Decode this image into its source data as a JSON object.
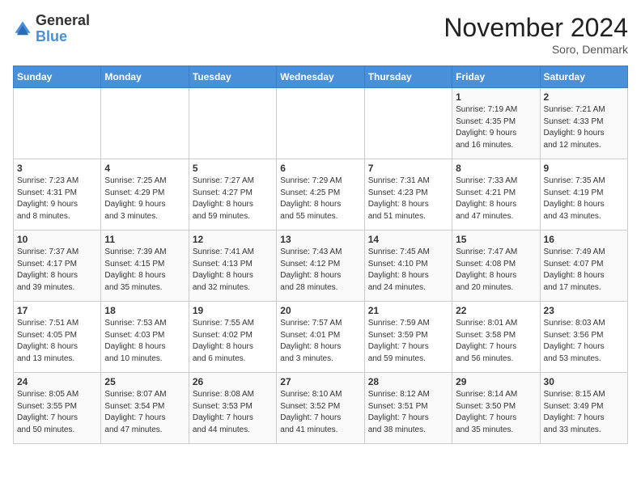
{
  "logo": {
    "line1": "General",
    "line2": "Blue"
  },
  "title": "November 2024",
  "subtitle": "Soro, Denmark",
  "days_of_week": [
    "Sunday",
    "Monday",
    "Tuesday",
    "Wednesday",
    "Thursday",
    "Friday",
    "Saturday"
  ],
  "weeks": [
    [
      {
        "day": "",
        "info": ""
      },
      {
        "day": "",
        "info": ""
      },
      {
        "day": "",
        "info": ""
      },
      {
        "day": "",
        "info": ""
      },
      {
        "day": "",
        "info": ""
      },
      {
        "day": "1",
        "info": "Sunrise: 7:19 AM\nSunset: 4:35 PM\nDaylight: 9 hours\nand 16 minutes."
      },
      {
        "day": "2",
        "info": "Sunrise: 7:21 AM\nSunset: 4:33 PM\nDaylight: 9 hours\nand 12 minutes."
      }
    ],
    [
      {
        "day": "3",
        "info": "Sunrise: 7:23 AM\nSunset: 4:31 PM\nDaylight: 9 hours\nand 8 minutes."
      },
      {
        "day": "4",
        "info": "Sunrise: 7:25 AM\nSunset: 4:29 PM\nDaylight: 9 hours\nand 3 minutes."
      },
      {
        "day": "5",
        "info": "Sunrise: 7:27 AM\nSunset: 4:27 PM\nDaylight: 8 hours\nand 59 minutes."
      },
      {
        "day": "6",
        "info": "Sunrise: 7:29 AM\nSunset: 4:25 PM\nDaylight: 8 hours\nand 55 minutes."
      },
      {
        "day": "7",
        "info": "Sunrise: 7:31 AM\nSunset: 4:23 PM\nDaylight: 8 hours\nand 51 minutes."
      },
      {
        "day": "8",
        "info": "Sunrise: 7:33 AM\nSunset: 4:21 PM\nDaylight: 8 hours\nand 47 minutes."
      },
      {
        "day": "9",
        "info": "Sunrise: 7:35 AM\nSunset: 4:19 PM\nDaylight: 8 hours\nand 43 minutes."
      }
    ],
    [
      {
        "day": "10",
        "info": "Sunrise: 7:37 AM\nSunset: 4:17 PM\nDaylight: 8 hours\nand 39 minutes."
      },
      {
        "day": "11",
        "info": "Sunrise: 7:39 AM\nSunset: 4:15 PM\nDaylight: 8 hours\nand 35 minutes."
      },
      {
        "day": "12",
        "info": "Sunrise: 7:41 AM\nSunset: 4:13 PM\nDaylight: 8 hours\nand 32 minutes."
      },
      {
        "day": "13",
        "info": "Sunrise: 7:43 AM\nSunset: 4:12 PM\nDaylight: 8 hours\nand 28 minutes."
      },
      {
        "day": "14",
        "info": "Sunrise: 7:45 AM\nSunset: 4:10 PM\nDaylight: 8 hours\nand 24 minutes."
      },
      {
        "day": "15",
        "info": "Sunrise: 7:47 AM\nSunset: 4:08 PM\nDaylight: 8 hours\nand 20 minutes."
      },
      {
        "day": "16",
        "info": "Sunrise: 7:49 AM\nSunset: 4:07 PM\nDaylight: 8 hours\nand 17 minutes."
      }
    ],
    [
      {
        "day": "17",
        "info": "Sunrise: 7:51 AM\nSunset: 4:05 PM\nDaylight: 8 hours\nand 13 minutes."
      },
      {
        "day": "18",
        "info": "Sunrise: 7:53 AM\nSunset: 4:03 PM\nDaylight: 8 hours\nand 10 minutes."
      },
      {
        "day": "19",
        "info": "Sunrise: 7:55 AM\nSunset: 4:02 PM\nDaylight: 8 hours\nand 6 minutes."
      },
      {
        "day": "20",
        "info": "Sunrise: 7:57 AM\nSunset: 4:01 PM\nDaylight: 8 hours\nand 3 minutes."
      },
      {
        "day": "21",
        "info": "Sunrise: 7:59 AM\nSunset: 3:59 PM\nDaylight: 7 hours\nand 59 minutes."
      },
      {
        "day": "22",
        "info": "Sunrise: 8:01 AM\nSunset: 3:58 PM\nDaylight: 7 hours\nand 56 minutes."
      },
      {
        "day": "23",
        "info": "Sunrise: 8:03 AM\nSunset: 3:56 PM\nDaylight: 7 hours\nand 53 minutes."
      }
    ],
    [
      {
        "day": "24",
        "info": "Sunrise: 8:05 AM\nSunset: 3:55 PM\nDaylight: 7 hours\nand 50 minutes."
      },
      {
        "day": "25",
        "info": "Sunrise: 8:07 AM\nSunset: 3:54 PM\nDaylight: 7 hours\nand 47 minutes."
      },
      {
        "day": "26",
        "info": "Sunrise: 8:08 AM\nSunset: 3:53 PM\nDaylight: 7 hours\nand 44 minutes."
      },
      {
        "day": "27",
        "info": "Sunrise: 8:10 AM\nSunset: 3:52 PM\nDaylight: 7 hours\nand 41 minutes."
      },
      {
        "day": "28",
        "info": "Sunrise: 8:12 AM\nSunset: 3:51 PM\nDaylight: 7 hours\nand 38 minutes."
      },
      {
        "day": "29",
        "info": "Sunrise: 8:14 AM\nSunset: 3:50 PM\nDaylight: 7 hours\nand 35 minutes."
      },
      {
        "day": "30",
        "info": "Sunrise: 8:15 AM\nSunset: 3:49 PM\nDaylight: 7 hours\nand 33 minutes."
      }
    ]
  ]
}
